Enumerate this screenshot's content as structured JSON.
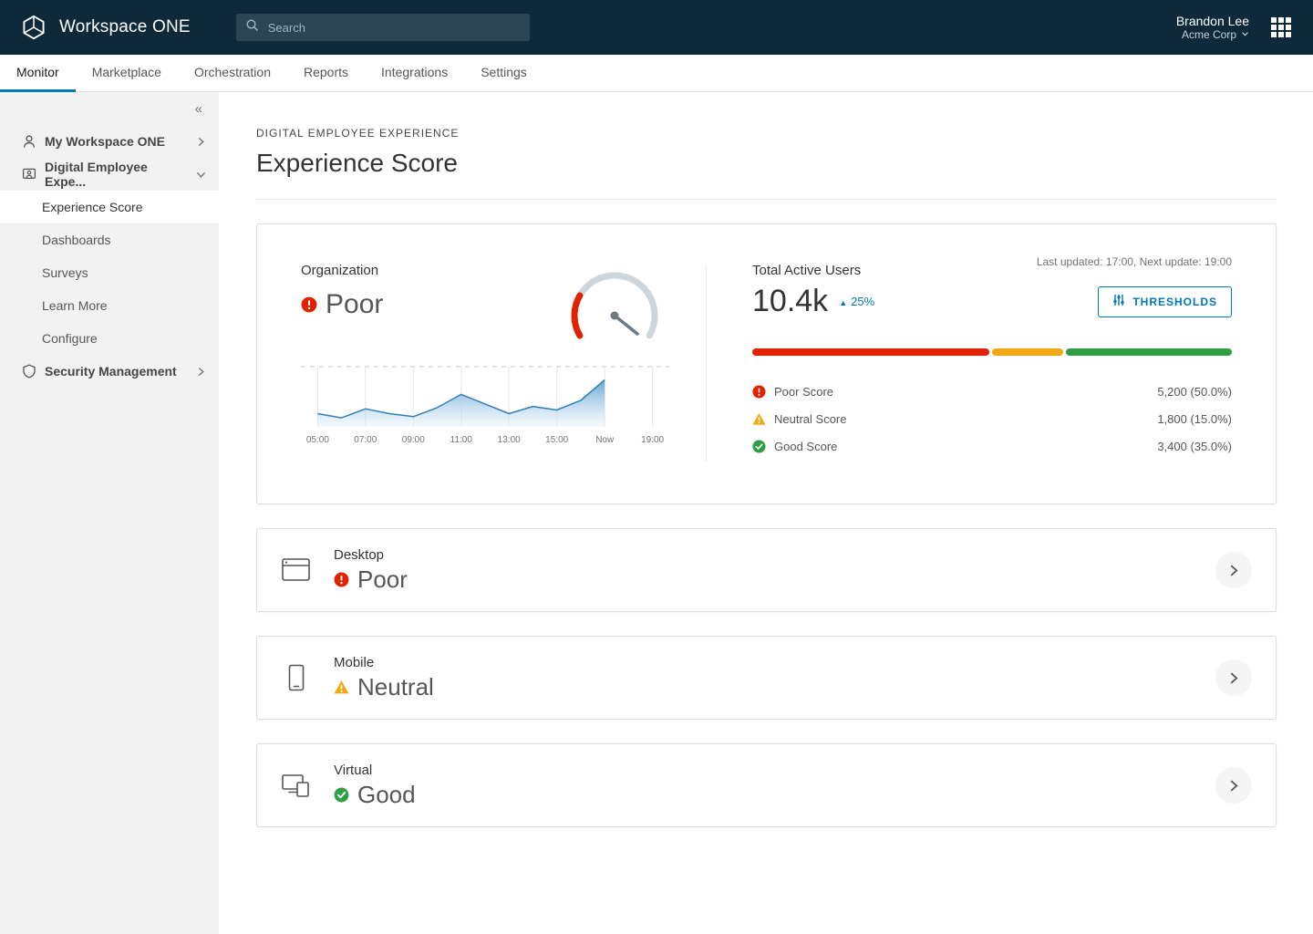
{
  "colors": {
    "accent": "#0079b8",
    "danger": "#e12200",
    "warning": "#f3a712",
    "success": "#2f9e44",
    "header_bg": "#0e2a3a"
  },
  "header": {
    "product": "Workspace ONE",
    "search_placeholder": "Search",
    "user_name": "Brandon Lee",
    "org_name": "Acme Corp"
  },
  "tabs": {
    "items": [
      {
        "label": "Monitor",
        "active": true
      },
      {
        "label": "Marketplace",
        "active": false
      },
      {
        "label": "Orchestration",
        "active": false
      },
      {
        "label": "Reports",
        "active": false
      },
      {
        "label": "Integrations",
        "active": false
      },
      {
        "label": "Settings",
        "active": false
      }
    ]
  },
  "sidebar": {
    "items": [
      {
        "label": "My Workspace ONE",
        "expanded": false
      },
      {
        "label": "Digital Employee Expe...",
        "expanded": true,
        "children": [
          "Experience Score",
          "Dashboards",
          "Surveys",
          "Learn More",
          "Configure"
        ],
        "selected_child": "Experience Score"
      },
      {
        "label": "Security Management",
        "expanded": false
      }
    ]
  },
  "page": {
    "eyebrow": "DIGITAL EMPLOYEE EXPERIENCE",
    "title": "Experience Score"
  },
  "organization": {
    "label": "Organization",
    "score": "Poor",
    "status": "poor",
    "users_label": "Total Active Users",
    "users_value": "10.4k",
    "trend": "25%",
    "updated": "Last updated: 17:00, Next update: 19:00",
    "thresholds_label": "THRESHOLDS",
    "legend": [
      {
        "label": "Poor Score",
        "value": "5,200 (50.0%)",
        "percent": 50,
        "color": "#e12200"
      },
      {
        "label": "Neutral Score",
        "value": "1,800 (15.0%)",
        "percent": 15,
        "color": "#f3a712"
      },
      {
        "label": "Good Score",
        "value": "3,400 (35.0%)",
        "percent": 35,
        "color": "#2f9e44"
      }
    ]
  },
  "devices": [
    {
      "label": "Desktop",
      "score": "Poor",
      "status": "poor"
    },
    {
      "label": "Mobile",
      "score": "Neutral",
      "status": "neutral"
    },
    {
      "label": "Virtual",
      "score": "Good",
      "status": "good"
    }
  ],
  "chart_data": {
    "type": "area",
    "x_hours": [
      5,
      6,
      7,
      8,
      9,
      10,
      11,
      12,
      13,
      14,
      15,
      16,
      17
    ],
    "values": [
      22,
      15,
      30,
      22,
      17,
      32,
      54,
      38,
      22,
      34,
      28,
      44,
      78
    ],
    "ticks": [
      {
        "h": 5,
        "label": "05:00"
      },
      {
        "h": 7,
        "label": "07:00"
      },
      {
        "h": 9,
        "label": "09:00"
      },
      {
        "h": 11,
        "label": "11:00"
      },
      {
        "h": 13,
        "label": "13:00"
      },
      {
        "h": 15,
        "label": "15:00"
      },
      {
        "h": 17,
        "label": "Now"
      },
      {
        "h": 19,
        "label": "19:00"
      }
    ],
    "x_range": [
      4.3,
      19.7
    ],
    "ylim": [
      0,
      100
    ],
    "grid": "vertical",
    "legend_position": "none"
  }
}
